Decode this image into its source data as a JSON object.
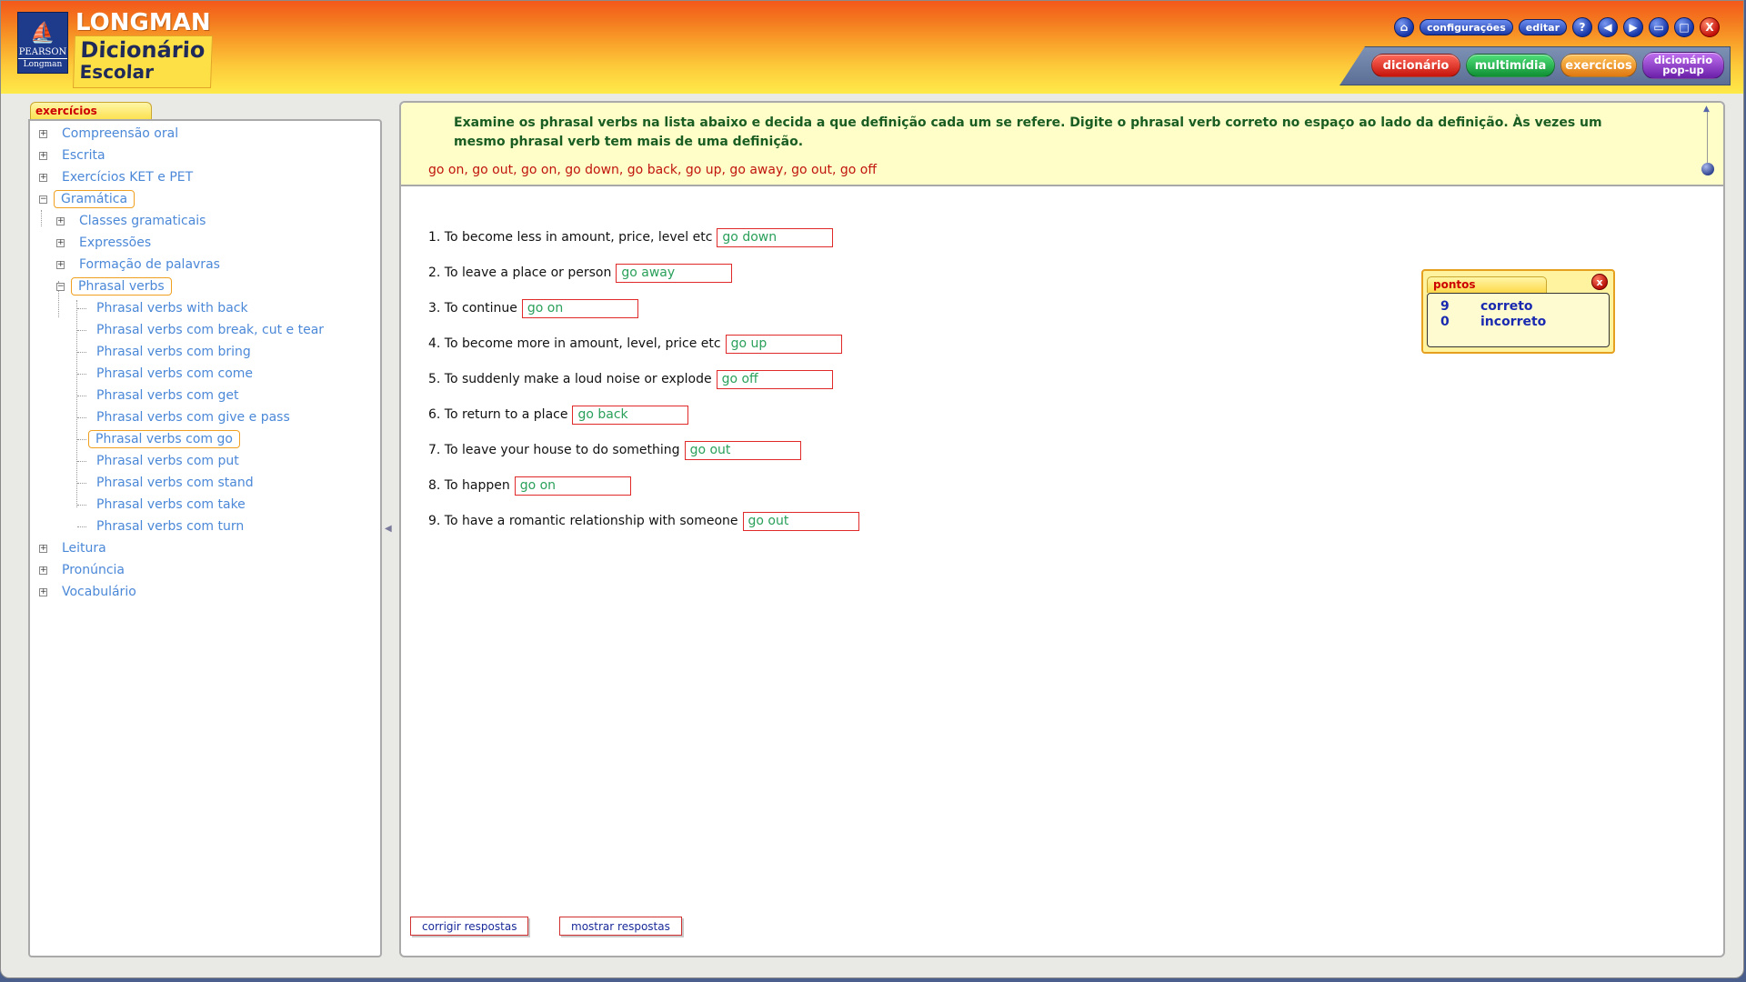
{
  "header": {
    "publisher_top": "PEARSON",
    "publisher_bottom": "Longman",
    "brand": "LONGMAN",
    "product_line1": "Dicionário",
    "product_line2": "Escolar",
    "top_buttons": {
      "home_icon": "home-icon",
      "settings_label": "configurações",
      "edit_label": "editar",
      "help_glyph": "?",
      "close_glyph": "X"
    },
    "nav_tabs": {
      "dictionary": "dicionário",
      "multimedia": "multimídia",
      "exercises": "exercícios",
      "popup_line1": "dicionário",
      "popup_line2": "pop-up"
    }
  },
  "sidebar": {
    "tab_label": "exercícios",
    "items": [
      {
        "label": "Compreensão oral"
      },
      {
        "label": "Escrita"
      },
      {
        "label": "Exercícios KET e PET"
      },
      {
        "label": "Gramática"
      },
      {
        "label": "Classes gramaticais"
      },
      {
        "label": "Expressões"
      },
      {
        "label": "Formação de palavras"
      },
      {
        "label": "Phrasal verbs"
      },
      {
        "label": "Phrasal verbs with back"
      },
      {
        "label": "Phrasal verbs com break, cut e tear"
      },
      {
        "label": "Phrasal verbs com bring"
      },
      {
        "label": "Phrasal verbs com come"
      },
      {
        "label": "Phrasal verbs com get"
      },
      {
        "label": "Phrasal verbs com give e pass"
      },
      {
        "label": "Phrasal verbs com go"
      },
      {
        "label": "Phrasal verbs com put"
      },
      {
        "label": "Phrasal verbs com stand"
      },
      {
        "label": "Phrasal verbs com take"
      },
      {
        "label": "Phrasal verbs com turn"
      },
      {
        "label": "Leitura"
      },
      {
        "label": "Pronúncia"
      },
      {
        "label": "Vocabulário"
      }
    ]
  },
  "exercise": {
    "instructions": "Examine os phrasal verbs na lista abaixo e decida a que definição cada um se refere. Digite o phrasal verb correto no espaço ao lado da definição. Às vezes um mesmo phrasal verb tem mais de uma definição.",
    "word_list": "go on, go out, go on, go down, go back, go up, go away, go out, go off",
    "questions": [
      {
        "text": "1. To become less in amount, price, level etc",
        "answer": "go down"
      },
      {
        "text": "2. To leave a place or person",
        "answer": "go away"
      },
      {
        "text": "3. To continue",
        "answer": "go on"
      },
      {
        "text": "4. To become more in amount, level, price etc",
        "answer": "go up"
      },
      {
        "text": "5. To suddenly make a loud noise or explode",
        "answer": "go off"
      },
      {
        "text": "6. To return to a place",
        "answer": "go back"
      },
      {
        "text": "7. To leave your house to do something",
        "answer": "go out"
      },
      {
        "text": "8. To happen",
        "answer": "go on"
      },
      {
        "text": "9. To have a romantic relationship with someone",
        "answer": "go out"
      }
    ],
    "check_label": "corrigir respostas",
    "show_label": "mostrar respostas"
  },
  "score": {
    "title": "pontos",
    "close_glyph": "x",
    "correct_count": "9",
    "correct_label": "correto",
    "incorrect_count": "0",
    "incorrect_label": "incorreto"
  },
  "colors": {
    "tree_link": "#4b88d8",
    "instruction_text": "#1a5d23",
    "word_list_text": "#c0140c",
    "answer_text": "#2aa05a",
    "input_border": "#e02a2a"
  }
}
